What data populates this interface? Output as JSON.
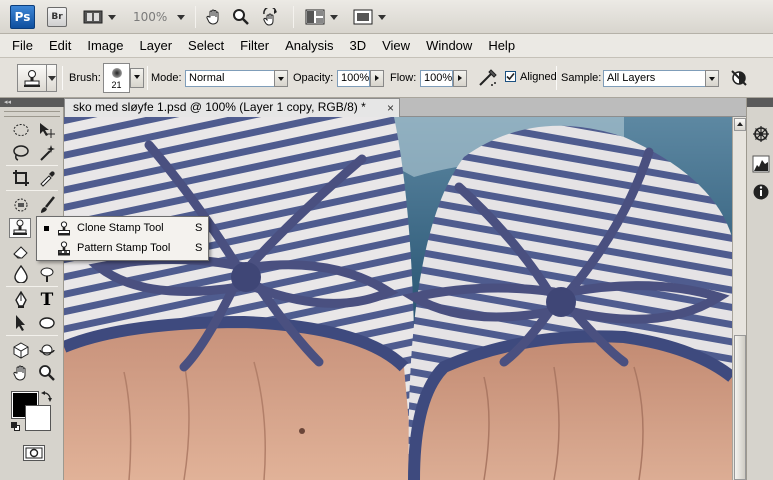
{
  "app_bar": {
    "ps_label": "Ps",
    "br_label": "Br",
    "zoom": "100%"
  },
  "menu": {
    "items": [
      "File",
      "Edit",
      "Image",
      "Layer",
      "Select",
      "Filter",
      "Analysis",
      "3D",
      "View",
      "Window",
      "Help"
    ]
  },
  "options": {
    "brush_label": "Brush:",
    "brush_size": "21",
    "mode_label": "Mode:",
    "mode_value": "Normal",
    "opacity_label": "Opacity:",
    "opacity_value": "100%",
    "flow_label": "Flow:",
    "flow_value": "100%",
    "aligned_label": "Aligned",
    "aligned_checked": true,
    "sample_label": "Sample:",
    "sample_value": "All Layers"
  },
  "document": {
    "tab_title": "sko med sløyfe 1.psd @ 100% (Layer 1 copy, RGB/8) *",
    "close_glyph": "×"
  },
  "toolbox": {
    "collapse_glyph": "◂◂",
    "type_tool_glyph": "T",
    "foreground_color": "#000000",
    "background_color": "#ffffff"
  },
  "flyout": {
    "items": [
      {
        "label": "Clone Stamp Tool",
        "shortcut": "S",
        "selected": true
      },
      {
        "label": "Pattern Stamp Tool",
        "shortcut": "S",
        "selected": false
      }
    ]
  },
  "colors": {
    "shoe_stripe": "#4f5c8f",
    "shoe_base": "#e9e7e8",
    "bow_cord": "#4a5080",
    "skin": "#d49f82",
    "background_water": "#2e5a78"
  }
}
